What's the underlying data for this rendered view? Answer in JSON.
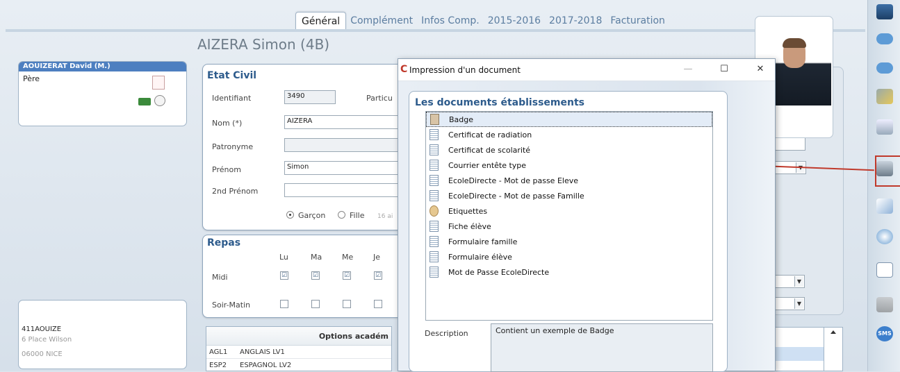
{
  "tabs": [
    "Général",
    "Complément",
    "Infos Comp.",
    "2015-2016",
    "2017-2018",
    "Facturation"
  ],
  "contact": {
    "header": "AOUIZERAT David (M.)",
    "role": "Père"
  },
  "address": {
    "line1": "411AOUIZE",
    "line2": "6 Place Wilson",
    "line3": "06000 NICE"
  },
  "student": {
    "title": "AIZERA Simon (4B)"
  },
  "etat_civil": {
    "title": "Etat Civil",
    "identifiant_label": "Identifiant",
    "identifiant_value": "3490",
    "particu_label": "Particu",
    "nom_label": "Nom (*)",
    "nom_value": "AIZERA",
    "patronyme_label": "Patronyme",
    "patronyme_value": "",
    "prenom_label": "Prénom",
    "prenom_value": "Simon",
    "prenom2_label": "2nd Prénom",
    "prenom2_value": "",
    "garcon_label": "Garçon",
    "fille_label": "Fille",
    "age_text": "16 ai"
  },
  "repas": {
    "title": "Repas",
    "days": [
      "Lu",
      "Ma",
      "Me",
      "Je"
    ],
    "midi_label": "Midi",
    "soir_label": "Soir-Matin",
    "midi_checks": [
      "☑",
      "☑",
      "☑",
      "☑"
    ]
  },
  "options": {
    "header": "Options académ",
    "rows": [
      {
        "code": "AGL1",
        "name": "ANGLAIS LV1"
      },
      {
        "code": "ESP2",
        "name": "ESPAGNOL LV2"
      }
    ]
  },
  "dialog": {
    "title": "Impression d'un document",
    "minimize": "—",
    "maximize": "☐",
    "close": "✕",
    "section_title": "Les documents établissements",
    "documents": [
      "Badge",
      "Certificat de radiation",
      "Certificat de scolarité",
      "Courrier entête type",
      "EcoleDirecte - Mot de passe Eleve",
      "EcoleDirecte - Mot de passe Famille",
      "Etiquettes",
      "Fiche élève",
      "Formulaire famille",
      "Formulaire élève",
      "Mot de Passe EcoleDirecte"
    ],
    "selected_index": 0,
    "description_label": "Description",
    "description_value": "Contient un exemple de Badge"
  },
  "colors": {
    "accent": "#2d5b8c",
    "highlight": "#c0392b",
    "header_blue": "#4d7fc0"
  },
  "sidebar_icons": [
    "computer-icon",
    "arrow-right-icon",
    "arrow-left-icon",
    "tools-icon",
    "trash-icon",
    "printer-icon",
    "mail-icon",
    "search-icon",
    "list-icon",
    "hand-icon",
    "sms-icon"
  ],
  "sidebar_labels": {
    "sms": "SMS"
  }
}
